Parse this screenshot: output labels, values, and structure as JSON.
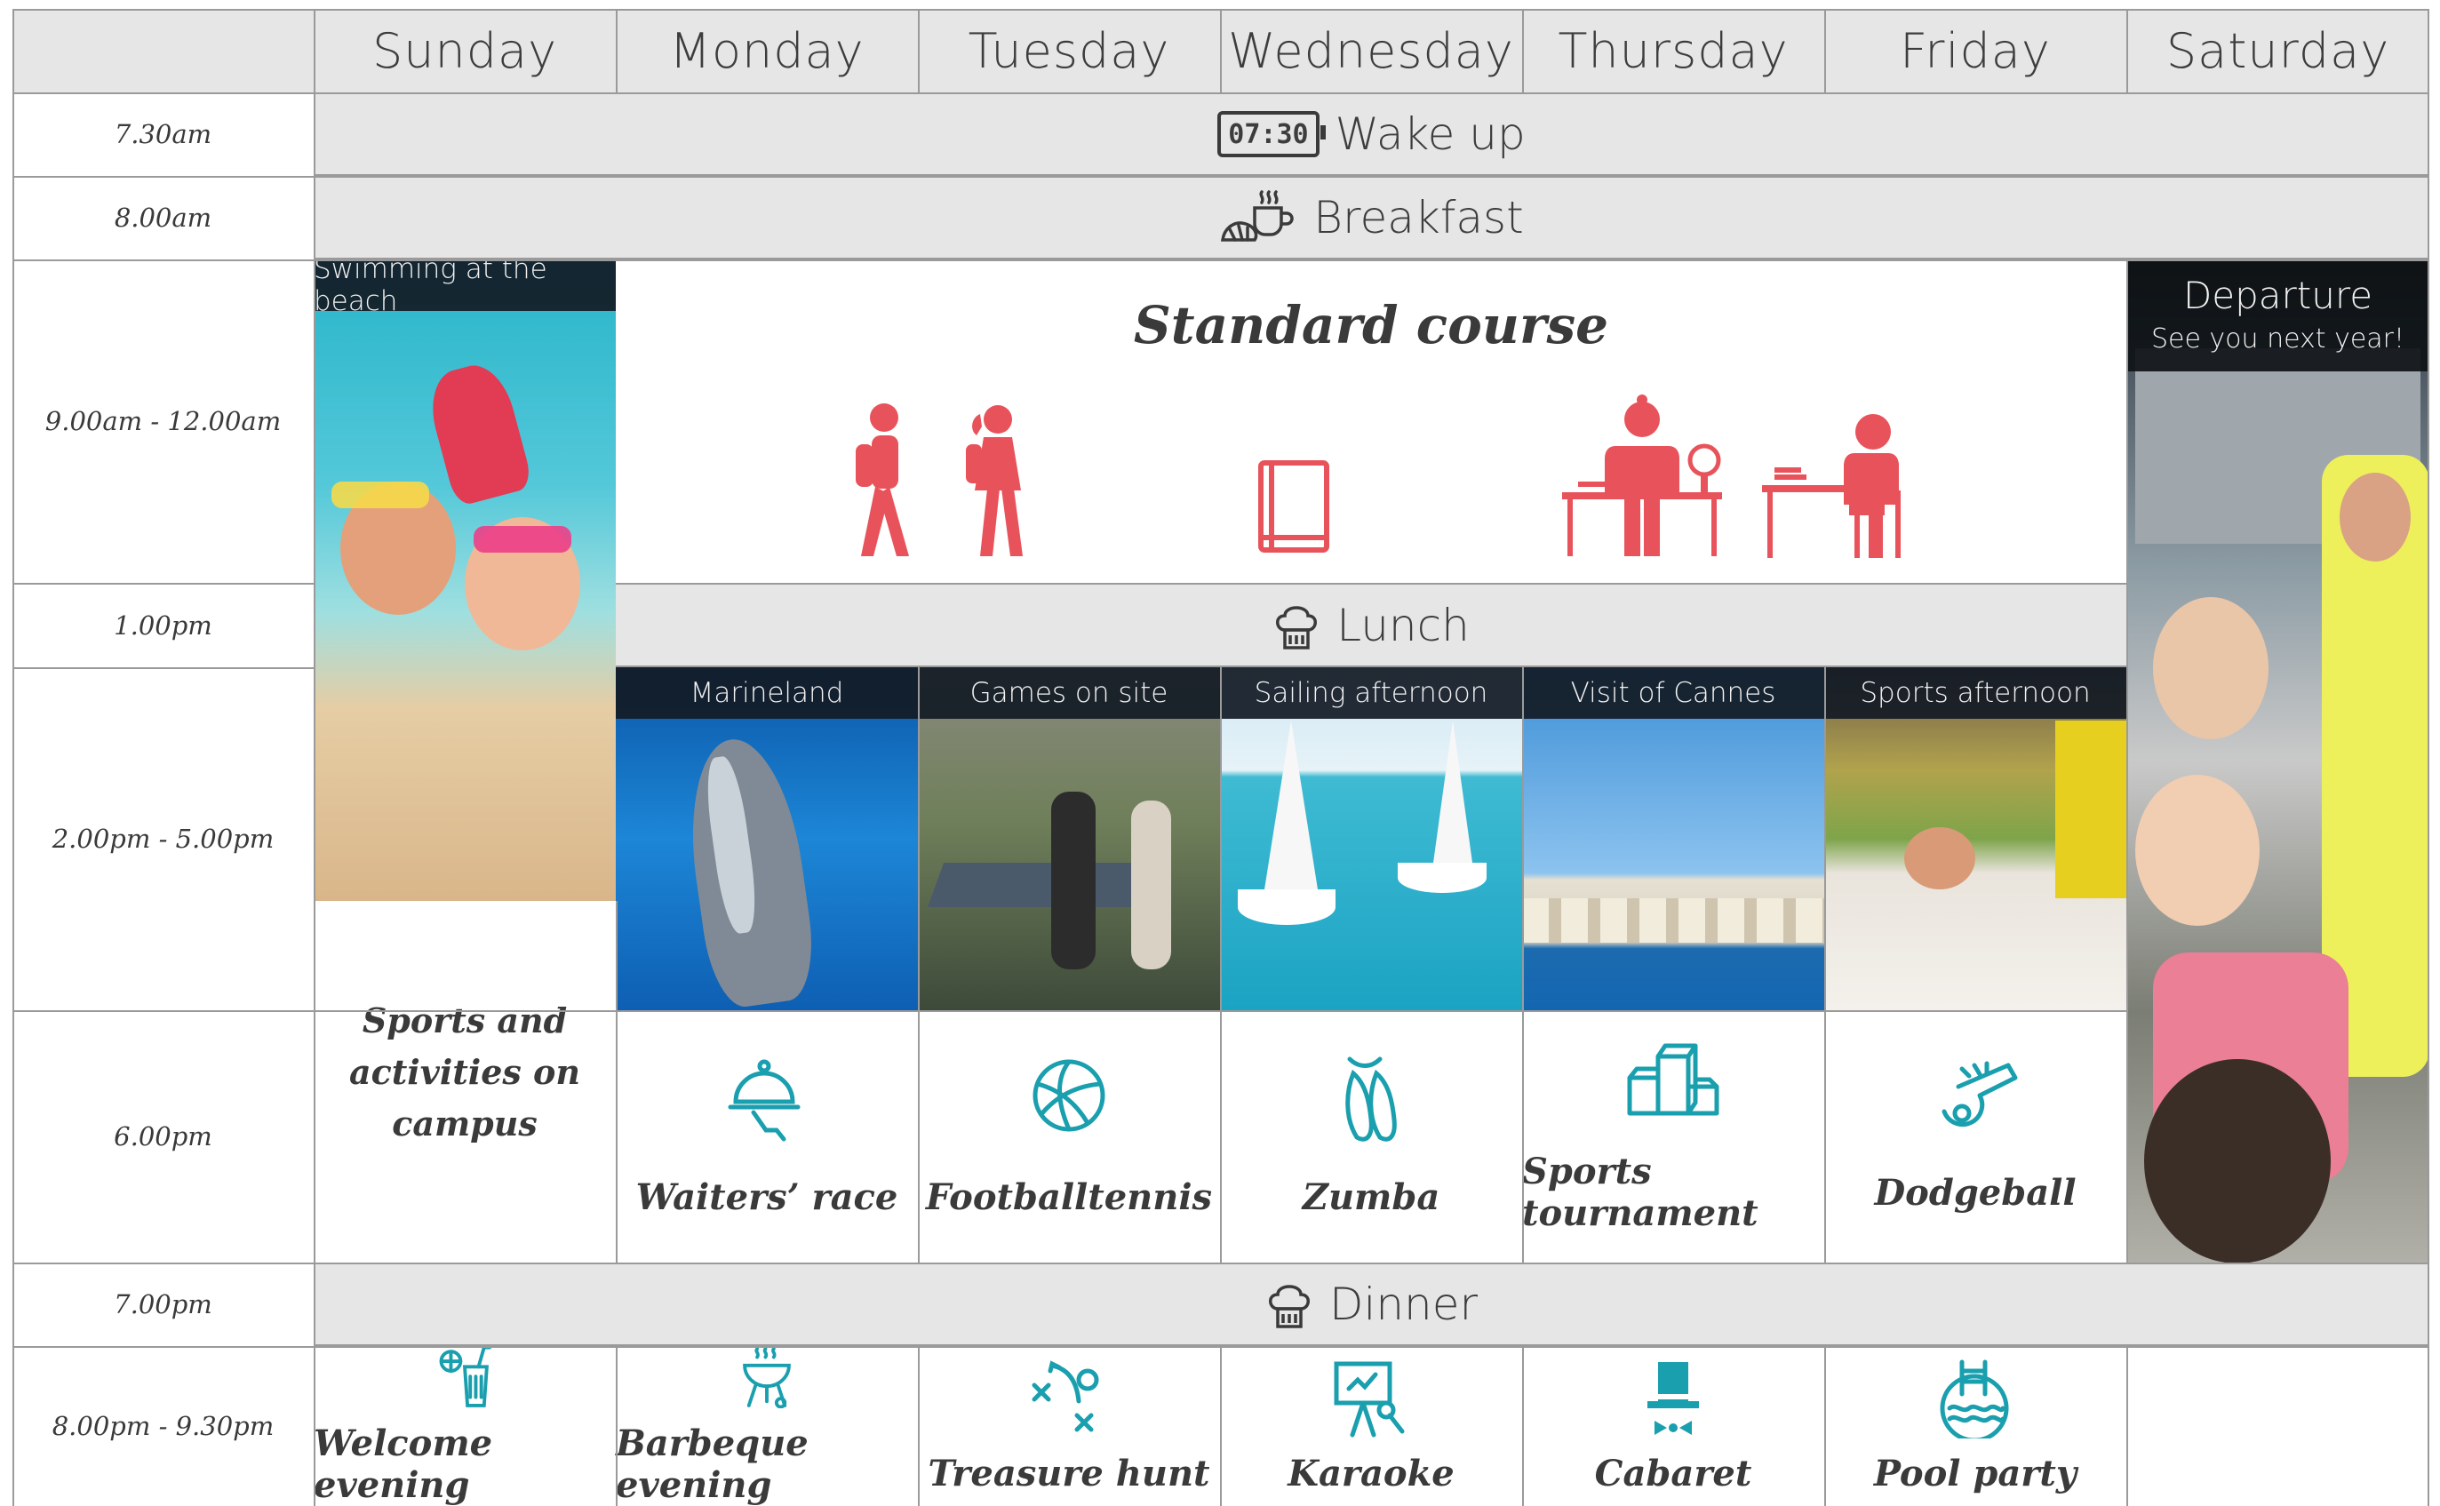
{
  "days": [
    "Sunday",
    "Monday",
    "Tuesday",
    "Wednesday",
    "Thursday",
    "Friday",
    "Saturday"
  ],
  "times": {
    "t730": "7.30am",
    "t800": "8.00am",
    "t900": "9.00am - 12.00am",
    "t100": "1.00pm",
    "t200": "2.00pm - 5.00pm",
    "t600": "6.00pm",
    "t700": "7.00pm",
    "t800pm": "8.00pm - 9.30pm"
  },
  "bands": {
    "wake": "Wake up",
    "wake_clock": "07:30",
    "breakfast": "Breakfast",
    "lunch": "Lunch",
    "dinner": "Dinner"
  },
  "sunday_photo_caption": "Swimming at the beach",
  "sunday_evening_activity": "Sports and activities on campus",
  "standard_course": "Standard course",
  "departure": {
    "title": "Departure",
    "subtitle": "See you next year!"
  },
  "afternoon": [
    {
      "caption": "Marineland",
      "icon": "dolphin-photo"
    },
    {
      "caption": "Games on site",
      "icon": "ping-pong-photo"
    },
    {
      "caption": "Sailing afternoon",
      "icon": "sailing-photo"
    },
    {
      "caption": "Visit of Cannes",
      "icon": "cannes-photo"
    },
    {
      "caption": "Sports afternoon",
      "icon": "waterslide-photo"
    }
  ],
  "six_pm": [
    {
      "label": "Waiters’ race",
      "icon": "cloche-icon"
    },
    {
      "label": "Footballtennis",
      "icon": "volleyball-icon"
    },
    {
      "label": "Zumba",
      "icon": "ballet-shoes-icon"
    },
    {
      "label": "Sports tournament",
      "icon": "podium-icon"
    },
    {
      "label": "Dodgeball",
      "icon": "whistle-icon"
    }
  ],
  "evening": [
    {
      "label": "Welcome evening",
      "icon": "cocktail-icon"
    },
    {
      "label": "Barbeque evening",
      "icon": "barbecue-icon"
    },
    {
      "label": "Treasure hunt",
      "icon": "strategy-icon"
    },
    {
      "label": "Karaoke",
      "icon": "karaoke-icon"
    },
    {
      "label": "Cabaret",
      "icon": "top-hat-icon"
    },
    {
      "label": "Pool party",
      "icon": "pool-icon"
    }
  ],
  "colors": {
    "course_red": "#e8535b",
    "teal": "#1a9fae",
    "band_grey": "#e6e6e6",
    "line_grey": "#9a9a9a"
  }
}
